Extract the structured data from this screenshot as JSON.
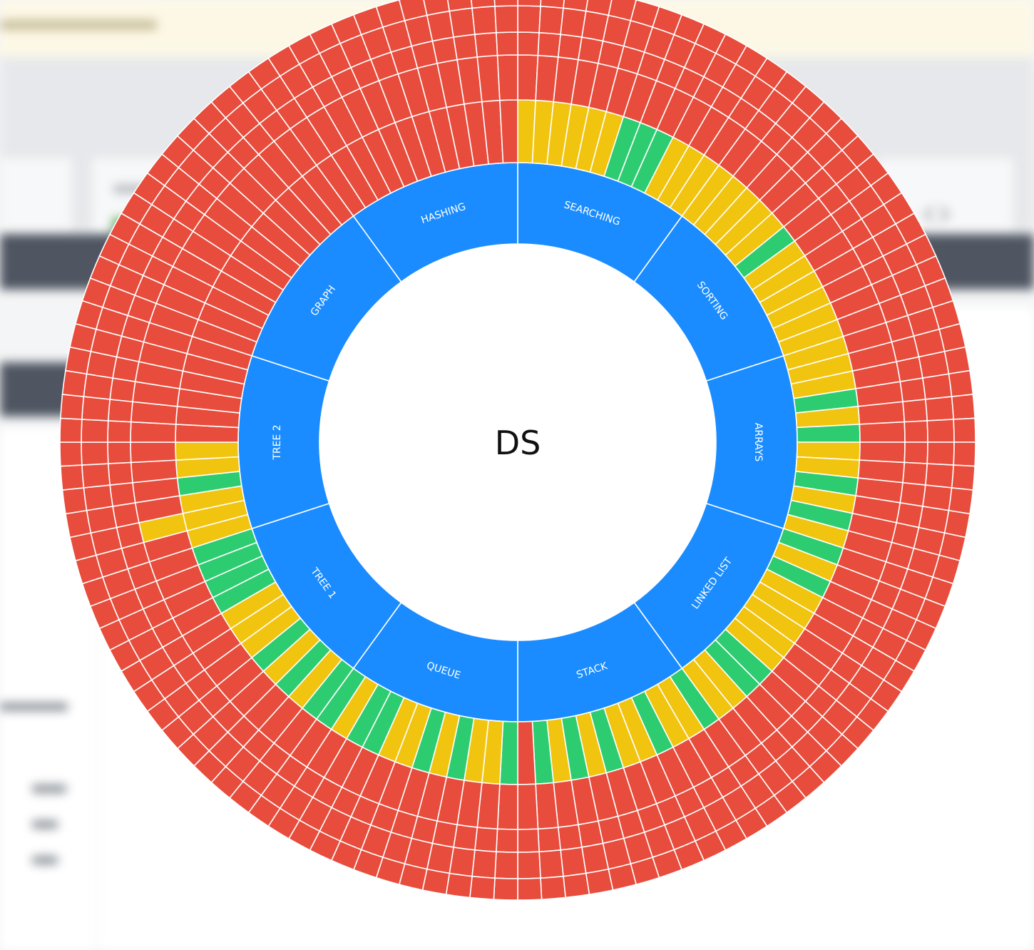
{
  "center_label": "DS",
  "colors": {
    "topic": "#1a8cff",
    "not_started": "#e74c3c",
    "in_progress": "#f1c40f",
    "done": "#2ecc71",
    "background_card_accent": "#6fb26a"
  },
  "legend_meaning": null,
  "chart_data": {
    "type": "sunburst",
    "center": "DS",
    "topics": [
      {
        "name": "SEARCHING",
        "problems": [
          [
            "in_progress",
            "not_started",
            "not_started",
            "not_started",
            "not_started"
          ],
          [
            "in_progress",
            "not_started",
            "not_started",
            "not_started",
            "not_started"
          ],
          [
            "in_progress",
            "not_started",
            "not_started",
            "not_started",
            "not_started"
          ],
          [
            "in_progress",
            "not_started",
            "not_started",
            "not_started",
            "not_started"
          ],
          [
            "in_progress",
            "not_started",
            "not_started",
            "not_started",
            "not_started"
          ],
          [
            "in_progress",
            "not_started",
            "not_started",
            "not_started",
            "not_started"
          ],
          [
            "done",
            "not_started",
            "not_started",
            "not_started",
            "not_started"
          ],
          [
            "done",
            "not_started",
            "not_started",
            "not_started",
            "not_started"
          ],
          [
            "done",
            "not_started",
            "not_started",
            "not_started",
            "not_started"
          ],
          [
            "in_progress",
            "not_started",
            "not_started",
            "not_started",
            "not_started"
          ],
          [
            "in_progress",
            "not_started",
            "not_started",
            "not_started",
            "not_started"
          ],
          [
            "in_progress",
            "not_started",
            "not_started",
            "not_started",
            "not_started"
          ]
        ]
      },
      {
        "name": "SORTING",
        "problems": [
          [
            "in_progress",
            "not_started",
            "not_started",
            "not_started",
            "not_started"
          ],
          [
            "in_progress",
            "not_started",
            "not_started",
            "not_started",
            "not_started"
          ],
          [
            "in_progress",
            "not_started",
            "not_started",
            "not_started",
            "not_started"
          ],
          [
            "in_progress",
            "not_started",
            "not_started",
            "not_started",
            "not_started"
          ],
          [
            "in_progress",
            "not_started",
            "not_started",
            "not_started",
            "not_started"
          ],
          [
            "done",
            "not_started",
            "not_started",
            "not_started",
            "not_started"
          ],
          [
            "in_progress",
            "not_started",
            "not_started",
            "not_started",
            "not_started"
          ],
          [
            "in_progress",
            "not_started",
            "not_started",
            "not_started",
            "not_started"
          ],
          [
            "in_progress",
            "not_started",
            "not_started",
            "not_started",
            "not_started"
          ],
          [
            "in_progress",
            "not_started",
            "not_started",
            "not_started",
            "not_started"
          ],
          [
            "in_progress",
            "not_started",
            "not_started",
            "not_started",
            "not_started"
          ],
          [
            "in_progress",
            "not_started",
            "not_started",
            "not_started",
            "not_started"
          ]
        ]
      },
      {
        "name": "ARRAYS",
        "problems": [
          [
            "in_progress",
            "not_started",
            "not_started",
            "not_started",
            "not_started"
          ],
          [
            "in_progress",
            "not_started",
            "not_started",
            "not_started",
            "not_started"
          ],
          [
            "in_progress",
            "not_started",
            "not_started",
            "not_started",
            "not_started"
          ],
          [
            "done",
            "not_started",
            "not_started",
            "not_started",
            "not_started"
          ],
          [
            "in_progress",
            "not_started",
            "not_started",
            "not_started",
            "not_started"
          ],
          [
            "done",
            "not_started",
            "not_started",
            "not_started",
            "not_started"
          ],
          [
            "in_progress",
            "not_started",
            "not_started",
            "not_started",
            "not_started"
          ],
          [
            "in_progress",
            "not_started",
            "not_started",
            "not_started",
            "not_started"
          ],
          [
            "done",
            "not_started",
            "not_started",
            "not_started",
            "not_started"
          ],
          [
            "in_progress",
            "not_started",
            "not_started",
            "not_started",
            "not_started"
          ],
          [
            "done",
            "not_started",
            "not_started",
            "not_started",
            "not_started"
          ],
          [
            "in_progress",
            "not_started",
            "not_started",
            "not_started",
            "not_started"
          ]
        ]
      },
      {
        "name": "LINKED LIST",
        "problems": [
          [
            "done",
            "not_started",
            "not_started",
            "not_started",
            "not_started"
          ],
          [
            "in_progress",
            "not_started",
            "not_started",
            "not_started",
            "not_started"
          ],
          [
            "done",
            "not_started",
            "not_started",
            "not_started",
            "not_started"
          ],
          [
            "in_progress",
            "not_started",
            "not_started",
            "not_started",
            "not_started"
          ],
          [
            "in_progress",
            "not_started",
            "not_started",
            "not_started",
            "not_started"
          ],
          [
            "in_progress",
            "not_started",
            "not_started",
            "not_started",
            "not_started"
          ],
          [
            "in_progress",
            "not_started",
            "not_started",
            "not_started",
            "not_started"
          ],
          [
            "in_progress",
            "not_started",
            "not_started",
            "not_started",
            "not_started"
          ],
          [
            "done",
            "not_started",
            "not_started",
            "not_started",
            "not_started"
          ],
          [
            "done",
            "not_started",
            "not_started",
            "not_started",
            "not_started"
          ],
          [
            "in_progress",
            "not_started",
            "not_started",
            "not_started",
            "not_started"
          ],
          [
            "in_progress",
            "not_started",
            "not_started",
            "not_started",
            "not_started"
          ]
        ]
      },
      {
        "name": "STACK",
        "problems": [
          [
            "done",
            "not_started",
            "not_started",
            "not_started",
            "not_started"
          ],
          [
            "in_progress",
            "not_started",
            "not_started",
            "not_started",
            "not_started"
          ],
          [
            "in_progress",
            "not_started",
            "not_started",
            "not_started",
            "not_started"
          ],
          [
            "done",
            "not_started",
            "not_started",
            "not_started",
            "not_started"
          ],
          [
            "in_progress",
            "not_started",
            "not_started",
            "not_started",
            "not_started"
          ],
          [
            "in_progress",
            "not_started",
            "not_started",
            "not_started",
            "not_started"
          ],
          [
            "done",
            "not_started",
            "not_started",
            "not_started",
            "not_started"
          ],
          [
            "in_progress",
            "not_started",
            "not_started",
            "not_started",
            "not_started"
          ],
          [
            "done",
            "not_started",
            "not_started",
            "not_started",
            "not_started"
          ],
          [
            "in_progress",
            "not_started",
            "not_started",
            "not_started",
            "not_started"
          ],
          [
            "done",
            "not_started",
            "not_started",
            "not_started",
            "not_started"
          ],
          [
            "not_started",
            "not_started",
            "not_started",
            "not_started",
            "not_started"
          ]
        ]
      },
      {
        "name": "QUEUE",
        "problems": [
          [
            "done",
            "not_started",
            "not_started",
            "not_started",
            "not_started"
          ],
          [
            "in_progress",
            "not_started",
            "not_started",
            "not_started",
            "not_started"
          ],
          [
            "in_progress",
            "not_started",
            "not_started",
            "not_started",
            "not_started"
          ],
          [
            "done",
            "not_started",
            "not_started",
            "not_started",
            "not_started"
          ],
          [
            "in_progress",
            "not_started",
            "not_started",
            "not_started",
            "not_started"
          ],
          [
            "done",
            "not_started",
            "not_started",
            "not_started",
            "not_started"
          ],
          [
            "in_progress",
            "not_started",
            "not_started",
            "not_started",
            "not_started"
          ],
          [
            "in_progress",
            "not_started",
            "not_started",
            "not_started",
            "not_started"
          ],
          [
            "done",
            "not_started",
            "not_started",
            "not_started",
            "not_started"
          ],
          [
            "done",
            "not_started",
            "not_started",
            "not_started",
            "not_started"
          ],
          [
            "in_progress",
            "not_started",
            "not_started",
            "not_started",
            "not_started"
          ],
          [
            "done",
            "not_started",
            "not_started",
            "not_started",
            "not_started"
          ]
        ]
      },
      {
        "name": "TREE 1",
        "problems": [
          [
            "done",
            "not_started",
            "not_started",
            "not_started",
            "not_started"
          ],
          [
            "in_progress",
            "not_started",
            "not_started",
            "not_started",
            "not_started"
          ],
          [
            "done",
            "not_started",
            "not_started",
            "not_started",
            "not_started"
          ],
          [
            "in_progress",
            "not_started",
            "not_started",
            "not_started",
            "not_started"
          ],
          [
            "done",
            "not_started",
            "not_started",
            "not_started",
            "not_started"
          ],
          [
            "in_progress",
            "not_started",
            "not_started",
            "not_started",
            "not_started"
          ],
          [
            "in_progress",
            "not_started",
            "not_started",
            "not_started",
            "not_started"
          ],
          [
            "in_progress",
            "not_started",
            "not_started",
            "not_started",
            "not_started"
          ],
          [
            "done",
            "not_started",
            "not_started",
            "not_started",
            "not_started"
          ],
          [
            "done",
            "not_started",
            "not_started",
            "not_started",
            "not_started"
          ],
          [
            "done",
            "not_started",
            "not_started",
            "not_started",
            "not_started"
          ],
          [
            "done",
            "not_started",
            "not_started",
            "not_started",
            "not_started"
          ]
        ]
      },
      {
        "name": "TREE 2",
        "problems": [
          [
            "in_progress",
            "not_started",
            "not_started",
            "not_started",
            "not_started"
          ],
          [
            "in_progress",
            "in_progress",
            "not_started",
            "not_started",
            "not_started"
          ],
          [
            "in_progress",
            "not_started",
            "not_started",
            "not_started",
            "not_started"
          ],
          [
            "done",
            "not_started",
            "not_started",
            "not_started",
            "not_started"
          ],
          [
            "in_progress",
            "not_started",
            "not_started",
            "not_started",
            "not_started"
          ],
          [
            "in_progress",
            "not_started",
            "not_started",
            "not_started",
            "not_started"
          ],
          [
            "not_started",
            "not_started",
            "not_started",
            "not_started",
            "not_started"
          ],
          [
            "not_started",
            "not_started",
            "not_started",
            "not_started",
            "not_started"
          ],
          [
            "not_started",
            "not_started",
            "not_started",
            "not_started",
            "not_started"
          ],
          [
            "not_started",
            "not_started",
            "not_started",
            "not_started",
            "not_started"
          ],
          [
            "not_started",
            "not_started",
            "not_started",
            "not_started",
            "not_started"
          ],
          [
            "not_started",
            "not_started",
            "not_started",
            "not_started",
            "not_started"
          ]
        ]
      },
      {
        "name": "GRAPH",
        "problems": [
          [
            "not_started",
            "not_started",
            "not_started",
            "not_started",
            "not_started"
          ],
          [
            "not_started",
            "not_started",
            "not_started",
            "not_started",
            "not_started"
          ],
          [
            "not_started",
            "not_started",
            "not_started",
            "not_started",
            "not_started"
          ],
          [
            "not_started",
            "not_started",
            "not_started",
            "not_started",
            "not_started"
          ],
          [
            "not_started",
            "not_started",
            "not_started",
            "not_started",
            "not_started"
          ],
          [
            "not_started",
            "not_started",
            "not_started",
            "not_started",
            "not_started"
          ],
          [
            "not_started",
            "not_started",
            "not_started",
            "not_started",
            "not_started"
          ],
          [
            "not_started",
            "not_started",
            "not_started",
            "not_started",
            "not_started"
          ],
          [
            "not_started",
            "not_started",
            "not_started",
            "not_started",
            "not_started"
          ],
          [
            "not_started",
            "not_started",
            "not_started",
            "not_started",
            "not_started"
          ],
          [
            "not_started",
            "not_started",
            "not_started",
            "not_started",
            "not_started"
          ],
          [
            "not_started",
            "not_started",
            "not_started",
            "not_started",
            "not_started"
          ]
        ]
      },
      {
        "name": "HASHING",
        "problems": [
          [
            "not_started",
            "not_started",
            "not_started",
            "not_started",
            "not_started"
          ],
          [
            "not_started",
            "not_started",
            "not_started",
            "not_started",
            "not_started"
          ],
          [
            "not_started",
            "not_started",
            "not_started",
            "not_started",
            "not_started"
          ],
          [
            "not_started",
            "not_started",
            "not_started",
            "not_started",
            "not_started"
          ],
          [
            "not_started",
            "not_started",
            "not_started",
            "not_started",
            "not_started"
          ],
          [
            "not_started",
            "not_started",
            "not_started",
            "not_started",
            "not_started"
          ],
          [
            "not_started",
            "not_started",
            "not_started",
            "not_started",
            "not_started"
          ],
          [
            "not_started",
            "not_started",
            "not_started",
            "not_started",
            "not_started"
          ],
          [
            "not_started",
            "not_started",
            "not_started",
            "not_started",
            "not_started"
          ],
          [
            "not_started",
            "not_started",
            "not_started",
            "not_started",
            "not_started"
          ],
          [
            "not_started",
            "not_started",
            "not_started",
            "not_started",
            "not_started"
          ],
          [
            "not_started",
            "not_started",
            "not_started",
            "not_started",
            "not_started"
          ]
        ]
      }
    ]
  }
}
